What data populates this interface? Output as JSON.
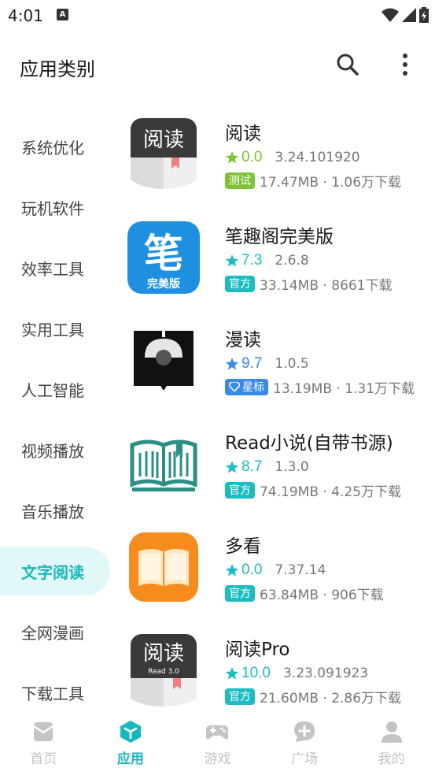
{
  "status": {
    "time": "4:01",
    "notification_letter": "A"
  },
  "header": {
    "title": "应用类别"
  },
  "sidebar": {
    "items": [
      {
        "label": "系统优化",
        "active": false
      },
      {
        "label": "玩机软件",
        "active": false
      },
      {
        "label": "效率工具",
        "active": false
      },
      {
        "label": "实用工具",
        "active": false
      },
      {
        "label": "人工智能",
        "active": false
      },
      {
        "label": "视频播放",
        "active": false
      },
      {
        "label": "音乐播放",
        "active": false
      },
      {
        "label": "文字阅读",
        "active": true
      },
      {
        "label": "全网漫画",
        "active": false
      },
      {
        "label": "下载工具",
        "active": false
      }
    ]
  },
  "apps": [
    {
      "name": "阅读",
      "icon_text": "阅读",
      "score": "0.0",
      "star_color": "#7ec335",
      "version": "3.24.101920",
      "badge": "测试",
      "badge_type": "test",
      "meta": "17.47MB · 1.06万下载"
    },
    {
      "name": "笔趣阁完美版",
      "icon_text": "笔",
      "icon_sub": "完美版",
      "score": "7.3",
      "star_color": "#1dbcc1",
      "version": "2.6.8",
      "badge": "官方",
      "badge_type": "official",
      "meta": "33.14MB · 8661下载"
    },
    {
      "name": "漫读",
      "score": "9.7",
      "star_color": "#3b8ae6",
      "version": "1.0.5",
      "badge": "星标",
      "badge_type": "star-badge",
      "meta": "13.19MB · 1.31万下载"
    },
    {
      "name": "Read小说(自带书源)",
      "score": "8.7",
      "star_color": "#1dbcc1",
      "version": "1.3.0",
      "badge": "官方",
      "badge_type": "official",
      "meta": "74.19MB · 4.25万下载"
    },
    {
      "name": "多看",
      "score": "0.0",
      "star_color": "#1dbcc1",
      "version": "7.37.14",
      "badge": "官方",
      "badge_type": "official",
      "meta": "63.84MB · 906下载"
    },
    {
      "name": "阅读Pro",
      "icon_text": "阅读",
      "icon_sub": "Read 3.0",
      "score": "10.0",
      "star_color": "#1dbcc1",
      "version": "3.23.091923",
      "badge": "官方",
      "badge_type": "official",
      "meta": "21.60MB · 2.86万下载"
    }
  ],
  "nav": [
    {
      "label": "首页",
      "icon": "home-icon",
      "active": false
    },
    {
      "label": "应用",
      "icon": "apps-cube-icon",
      "active": true
    },
    {
      "label": "游戏",
      "icon": "gamepad-icon",
      "active": false
    },
    {
      "label": "广场",
      "icon": "chat-bubble-icon",
      "active": false
    },
    {
      "label": "我的",
      "icon": "person-icon",
      "active": false
    }
  ],
  "colors": {
    "accent": "#15b9bd",
    "active_bg": "#e2f7f7",
    "inactive_nav": "#c4c4c4"
  }
}
